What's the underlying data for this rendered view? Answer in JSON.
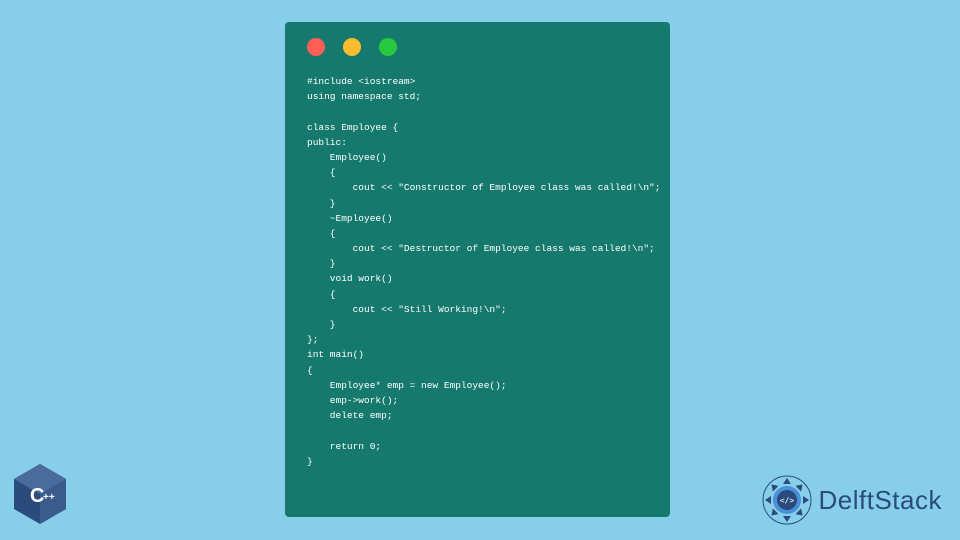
{
  "code": {
    "lines": "#include <iostream>\nusing namespace std;\n\nclass Employee {\npublic:\n    Employee()\n    {\n        cout << \"Constructor of Employee class was called!\\n\";\n    }\n    ~Employee()\n    {\n        cout << \"Destructor of Employee class was called!\\n\";\n    }\n    void work()\n    {\n        cout << \"Still Working!\\n\";\n    }\n};\nint main()\n{\n    Employee* emp = new Employee();\n    emp->work();\n    delete emp;\n\n    return 0;\n}"
  },
  "branding": {
    "site_name": "DelftStack",
    "language_badge": "C++"
  },
  "colors": {
    "bg": "#87ceeb",
    "window": "#15796e",
    "badge": "#2a4b7c",
    "delft_blue": "#2a4b7c"
  }
}
